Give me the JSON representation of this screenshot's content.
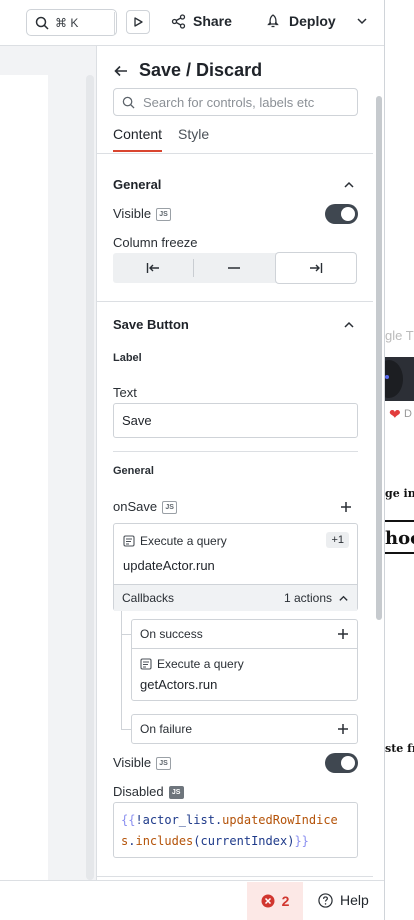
{
  "topbar": {
    "search_shortcut": "⌘ K",
    "share_label": "Share",
    "deploy_label": "Deploy"
  },
  "pane": {
    "widget_name": "Save / Discard",
    "search_placeholder": "Search for controls, labels etc",
    "tabs": [
      {
        "label": "Content",
        "active": true
      },
      {
        "label": "Style",
        "active": false
      }
    ],
    "general": {
      "title": "General",
      "visible_label": "Visible",
      "visible_on": true,
      "column_freeze_label": "Column freeze",
      "freeze_options": [
        "freeze-left",
        "no-freeze",
        "freeze-right"
      ],
      "freeze_selected": "freeze-right"
    },
    "save_button": {
      "title": "Save Button",
      "label_section": "Label",
      "text_label": "Text",
      "text_value": "Save",
      "general_section": "General",
      "on_save_label": "onSave",
      "action": {
        "type": "Execute a query",
        "extra": "+1",
        "query": "updateActor.run"
      },
      "callbacks": {
        "label": "Callbacks",
        "count": "1 actions"
      },
      "on_success": {
        "label": "On success",
        "type": "Execute a query",
        "query": "getActors.run"
      },
      "on_failure": {
        "label": "On failure"
      },
      "visible_label": "Visible",
      "visible_on": true,
      "disabled_label": "Disabled",
      "disabled_code": {
        "open": "{{",
        "var": "!actor_list",
        "dot1": ".",
        "prop1": "updatedRowIndices",
        "dot2": ".",
        "prop2": "includes",
        "paren_open": "(",
        "arg": "currentIndex",
        "paren_close": ")",
        "close": "}}"
      }
    }
  },
  "bottombar": {
    "error_count": "2",
    "help_label": "Help"
  },
  "background": {
    "strip_text_1": "gle Tr",
    "strip_text_2": "ge inf",
    "strip_text_3": "hoo",
    "strip_text_4": "ste fr",
    "strip_text_5": "D"
  },
  "colors": {
    "accent": "#d9452f",
    "toggle_on": "#3f4750",
    "error": "#d1362f"
  }
}
